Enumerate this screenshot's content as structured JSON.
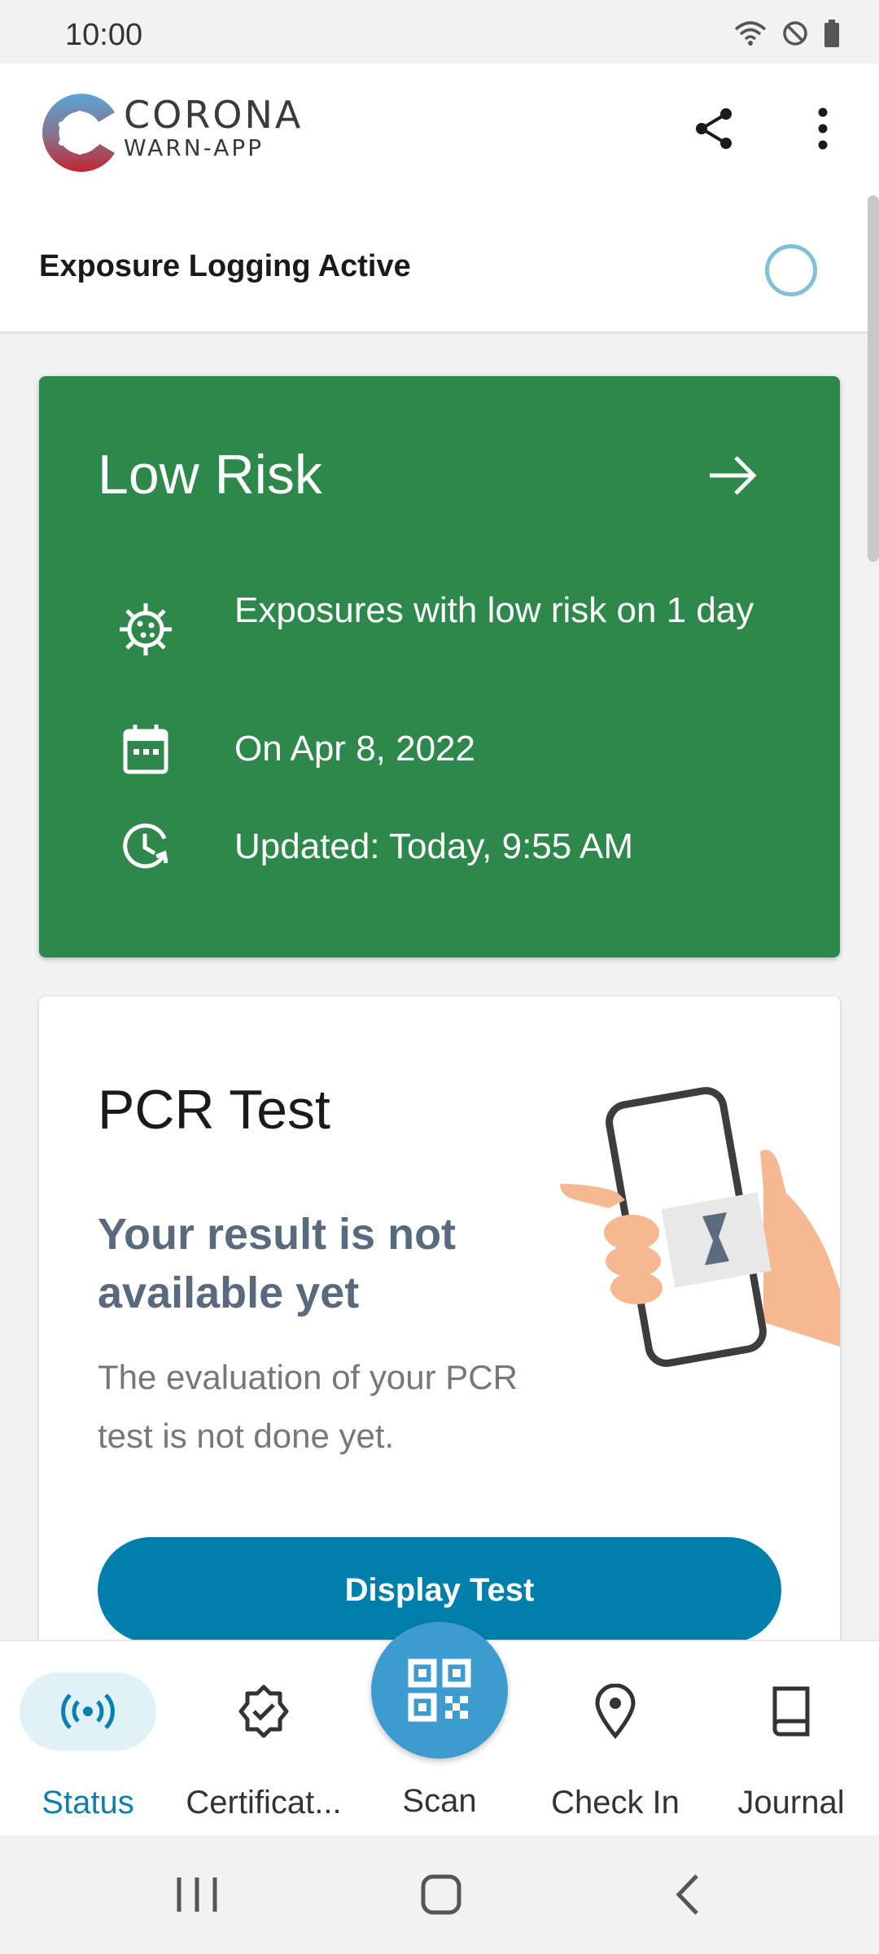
{
  "status_bar": {
    "time": "10:00"
  },
  "app": {
    "logo_line1": "CORONA",
    "logo_line2": "WARN-APP"
  },
  "logging": {
    "label": "Exposure Logging Active"
  },
  "risk_card": {
    "title": "Low Risk",
    "color": "#2e874b",
    "rows": [
      {
        "icon": "virus-icon",
        "text": "Exposures with low risk on 1 day"
      },
      {
        "icon": "calendar-icon",
        "text": "On Apr 8, 2022"
      },
      {
        "icon": "clock-refresh-icon",
        "text": "Updated: Today, 9:55 AM"
      }
    ]
  },
  "pcr_card": {
    "title": "PCR Test",
    "subtitle": "Your result is not available yet",
    "description": "The evaluation of your PCR test is not done yet.",
    "button_label": "Display Test",
    "button_color": "#007fad"
  },
  "bottom_nav": {
    "items": [
      {
        "label": "Status",
        "icon": "broadcast-icon",
        "active": true
      },
      {
        "label": "Certificat...",
        "icon": "badge-check-icon",
        "active": false
      },
      {
        "label": "Scan",
        "icon": "qr-code-icon",
        "active": false
      },
      {
        "label": "Check In",
        "icon": "location-pin-icon",
        "active": false
      },
      {
        "label": "Journal",
        "icon": "book-icon",
        "active": false
      }
    ],
    "accent": "#0c7fb0"
  }
}
